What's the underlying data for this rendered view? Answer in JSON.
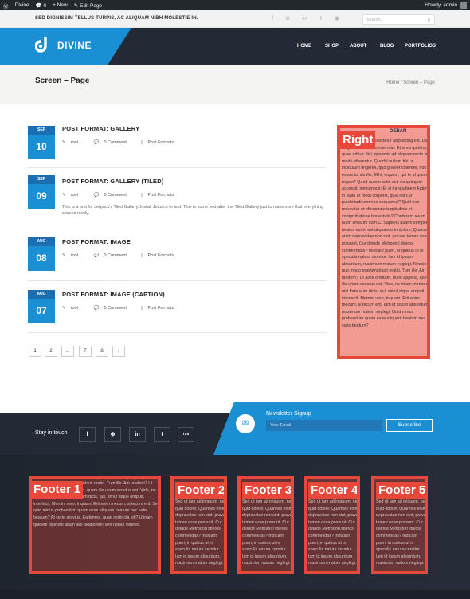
{
  "adminbar": {
    "site": "Divine",
    "comments": "0",
    "new_label": "New",
    "edit_label": "Edit Page",
    "howdy": "Howdy, admin"
  },
  "topbar": {
    "tagline": "SED DIGNISSIM TELLUS TURPIS, AC ALIQUAM NIBH MOLESTIE IN.",
    "search_placeholder": "Search...",
    "social_icons": [
      "facebook-icon",
      "dribbble-icon",
      "linkedin-icon",
      "twitter-icon",
      "rss-icon"
    ]
  },
  "header": {
    "logo_text": "DIVINE",
    "nav": [
      "HOME",
      "SHOP",
      "ABOUT",
      "BLOG",
      "PORTFOLIOS"
    ]
  },
  "page": {
    "title": "Screen – Page",
    "breadcrumb": "Home / Screen – Page"
  },
  "posts": [
    {
      "month": "SEP",
      "day": "10",
      "title": "POST FORMAT: GALLERY",
      "author": "root",
      "comments": "0 Comment",
      "category": "Post Formats",
      "excerpt": ""
    },
    {
      "month": "SEP",
      "day": "09",
      "title": "POST FORMAT: GALLERY (TILED)",
      "author": "root",
      "comments": "0 Comment",
      "category": "Post Formats",
      "excerpt": "This is a test for Jetpack's Tiled Gallery. Install Jetpack to test. This is some text after the Tiled Gallery just to make sure that everything spaces nicely."
    },
    {
      "month": "AUG",
      "day": "08",
      "title": "POST FORMAT: IMAGE",
      "author": "root",
      "comments": "0 Comment",
      "category": "Post Formats",
      "excerpt": ""
    },
    {
      "month": "AUG",
      "day": "07",
      "title": "POST FORMAT: IMAGE (CAPTION)",
      "author": "root",
      "comments": "0 Comment",
      "category": "Post Formats",
      "excerpt": ""
    }
  ],
  "pagination": [
    "1",
    "2",
    "...",
    "7",
    "8",
    "›"
  ],
  "sidebar": {
    "label": "Right",
    "widget_title": "DEBAR",
    "text": "Nam sit amet, consectetur adipisicing elit. Duo Reges: constructio interrete. Et si ea quidem, quae adhuc dixi, quamvis ad aliquam recte isto modo efferentur. Quodsi vultum tibi, si incessum fingeres, quo gravior viderere, non esses tui similis; Mihi, inquam, qui te id ipsum rogavi? Quod autem satis est, eo quicquid accessit, nimium est; Et si turpitudinem fugimus in statu et motu corporis, quid est cur pulchritudinem non sequamur? Quid non moveatur et offensione turpitudinis et comprobatione honestatis? Conferam avum tuum Drusum cum C. Sapiens autem semper beatus est et est aliquando in dolore; Quamvis enim depravatae non sint, pravae tamen esse possunt. Cur deinde Metrodori liberos commendas? Indicant pueri, in quibus ut in speculis natura cernitur. Iam id ipsum absurdum, maximum malum neglegi. Nescio quo modo praetervolavit oratio. Tum ille: Ain tandem? Ut alios omittam, hunc appello, quem ille unum secutus est. Vide, ne etiam menses! nisi forte eum dicis, qui, simul atque arripuit, interfecit. Memini vero, inquam; Erit enim mecum, si tecum erit. Iam id ipsum absurdum, maximum malum neglegi. Quid minus probandum quam esse aliquem beatum nec satis beatum?"
  },
  "newsletter": {
    "stay_label": "Stay in touch",
    "social_buttons": [
      "f",
      "⊛",
      "in",
      "t",
      "rss"
    ],
    "title": "Newsletter Signup",
    "email_placeholder": "Your Email",
    "subscribe_label": "Subscribe"
  },
  "footer": {
    "col1": {
      "label": "Footer 1",
      "text": "Nescio quo modo praetervolavit oratio. Tum ille: Ain tandem? Ut alios omittam, hunc appello, quem ille unum secutus est. Vide, ne etiam menses! nisi forte eum dicis, qui, simul atque arripuit, interfecit. Memini vero, inquam. Erit enim mecum, si tecum erit. Sed quid minus probandum quam esse aliquem beatum nec satis beatum? At certe gravius. Eademne, quae restincta siti? Utinam quidem dicerent alium alio beatiorem! Iam ruinas videres."
    },
    "col2": {
      "label": "Footer 2",
      "text": "Sed ut iam ad iniquum, ne quid dolore; Quamvis enim depravatae non sint, pravae tamen esse possunt. Cur deinde Metrodori liberos commendas? Indicant pueri, in quibus ut in speculis natura cernitur. Iam id ipsum absurdum, maximum malum neglegi."
    },
    "col3": {
      "label": "Footer 3",
      "text": "Sed ut iam ad iniquum, ne quid dolore; Quamvis enim depravatae non sint, pravae tamen esse possunt. Cur deinde Metrodori liberos commendas? Indicant pueri, in quibus ut in speculis natura cernitur. Iam id ipsum absurdum, maximum malum neglegi."
    },
    "col4": {
      "label": "Footer 4",
      "text": "Sed ut iam ad iniquum, ne quid dolore; Quamvis enim depravatae non sint, pravae tamen esse possunt. Cur deinde Metrodori liberos commendas? Indicant pueri, in quibus ut in speculis natura cernitur. Iam id ipsum absurdum, maximum malum neglegi."
    },
    "col5": {
      "label": "Footer 5",
      "text": "Sed ut iam ad iniquum, ne quid dolore; Quamvis enim depravatae non sint, pravae tamen esse possunt. Cur deinde Metrodori liberos commendas? Indicant pueri, in quibus ut in speculis natura cernitur. Iam id ipsum absurdum, maximum malum neglegi."
    }
  },
  "colors": {
    "accent": "#1a8fd3",
    "dark": "#232a36",
    "annotation": "#e8483a"
  }
}
